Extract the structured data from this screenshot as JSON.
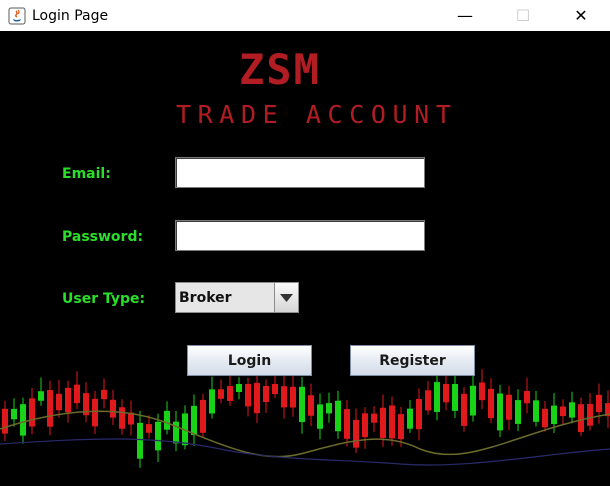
{
  "window": {
    "title": "Login Page",
    "minimize_glyph": "—",
    "maximize_glyph": "☐",
    "close_glyph": "✕"
  },
  "logo": {
    "main": "ZSM",
    "sub": "TRADE ACCOUNT",
    "color": "#b11d22"
  },
  "form": {
    "email_label": "Email:",
    "email_value": "",
    "password_label": "Password:",
    "password_value": "",
    "user_type_label": "User Type:",
    "user_type_selected": "Broker",
    "label_color": "#2adf2a"
  },
  "buttons": {
    "login": "Login",
    "register": "Register"
  },
  "decor": {
    "background": "candlestick-chart-image",
    "up_color": "#19d319",
    "down_color": "#e0191c"
  }
}
